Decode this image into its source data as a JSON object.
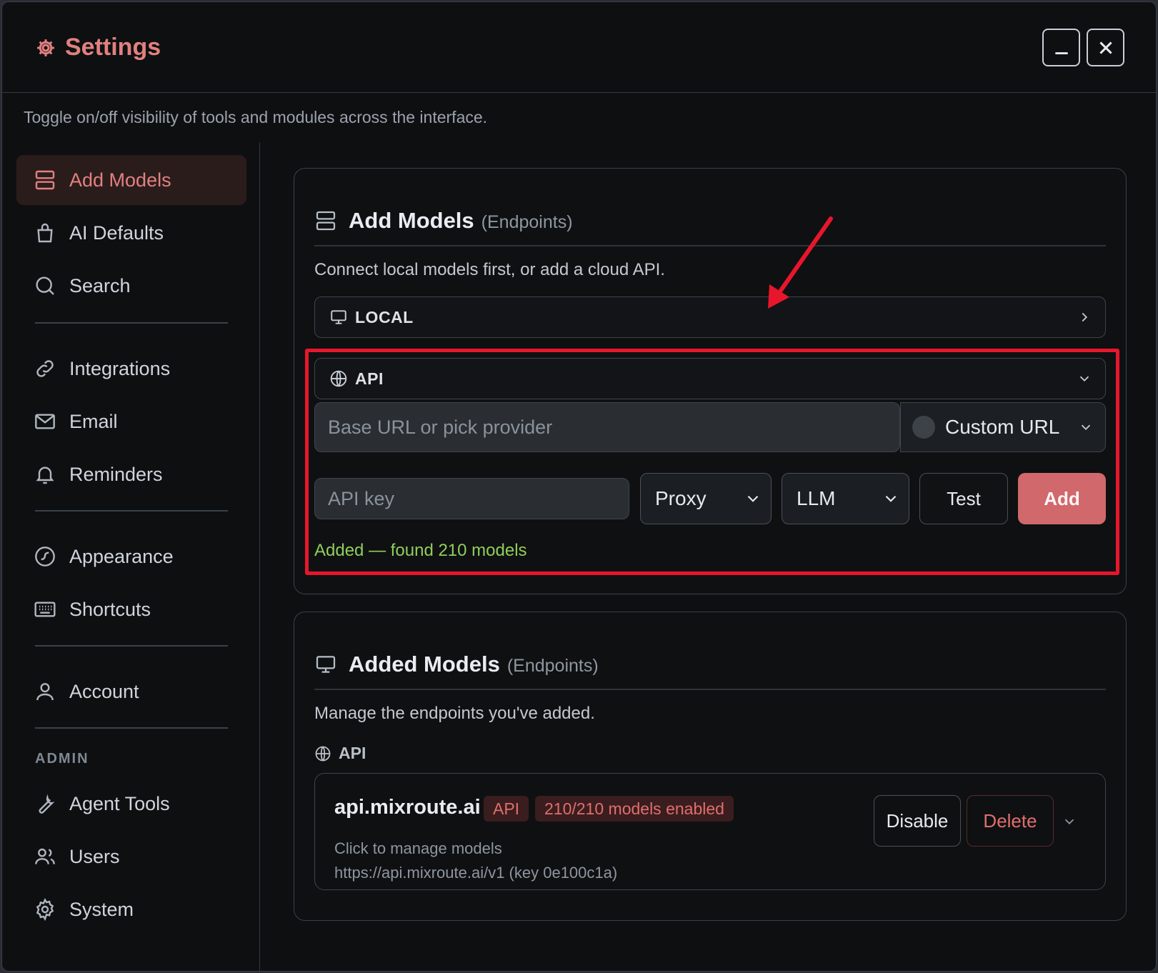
{
  "window": {
    "title": "Settings",
    "subtitle": "Toggle on/off visibility of tools and modules across the interface.",
    "minimize_icon": "minus-icon",
    "close_icon": "close-icon"
  },
  "sidebar": {
    "items": [
      {
        "label": "Add Models",
        "icon": "server-icon",
        "active": true
      },
      {
        "label": "AI Defaults",
        "icon": "bag-icon"
      },
      {
        "label": "Search",
        "icon": "search-icon"
      },
      {
        "label": "Integrations",
        "icon": "link-icon"
      },
      {
        "label": "Email",
        "icon": "mail-icon"
      },
      {
        "label": "Reminders",
        "icon": "bell-icon"
      },
      {
        "label": "Appearance",
        "icon": "palette-icon"
      },
      {
        "label": "Shortcuts",
        "icon": "keyboard-icon"
      },
      {
        "label": "Account",
        "icon": "user-icon"
      },
      {
        "label": "Agent Tools",
        "icon": "wrench-icon"
      },
      {
        "label": "Users",
        "icon": "users-icon"
      },
      {
        "label": "System",
        "icon": "gear-icon"
      }
    ],
    "admin_heading": "ADMIN"
  },
  "add_models": {
    "title": "Add Models",
    "suffix": "(Endpoints)",
    "description": "Connect local models first, or add a cloud API.",
    "local_label": "LOCAL",
    "api_label": "API",
    "base_url_placeholder": "Base URL or pick provider",
    "custom_url_label": "Custom URL",
    "api_key_placeholder": "API key",
    "proxy_value": "Proxy",
    "type_value": "LLM",
    "test_label": "Test",
    "add_label": "Add",
    "status": "Added — found 210 models"
  },
  "added_models": {
    "title": "Added Models",
    "suffix": "(Endpoints)",
    "description": "Manage the endpoints you've added.",
    "section_label": "API",
    "endpoint": {
      "name": "api.mixroute.ai",
      "badge_type": "API",
      "badge_count": "210/210 models enabled",
      "hint": "Click to manage models",
      "url": "https://api.mixroute.ai/v1 (key 0e100c1a)",
      "disable_label": "Disable",
      "delete_label": "Delete"
    }
  },
  "colors": {
    "accent": "#e1817f",
    "add_button": "#d1686b",
    "success": "#8fce5b",
    "highlight_box": "#e8162c"
  }
}
